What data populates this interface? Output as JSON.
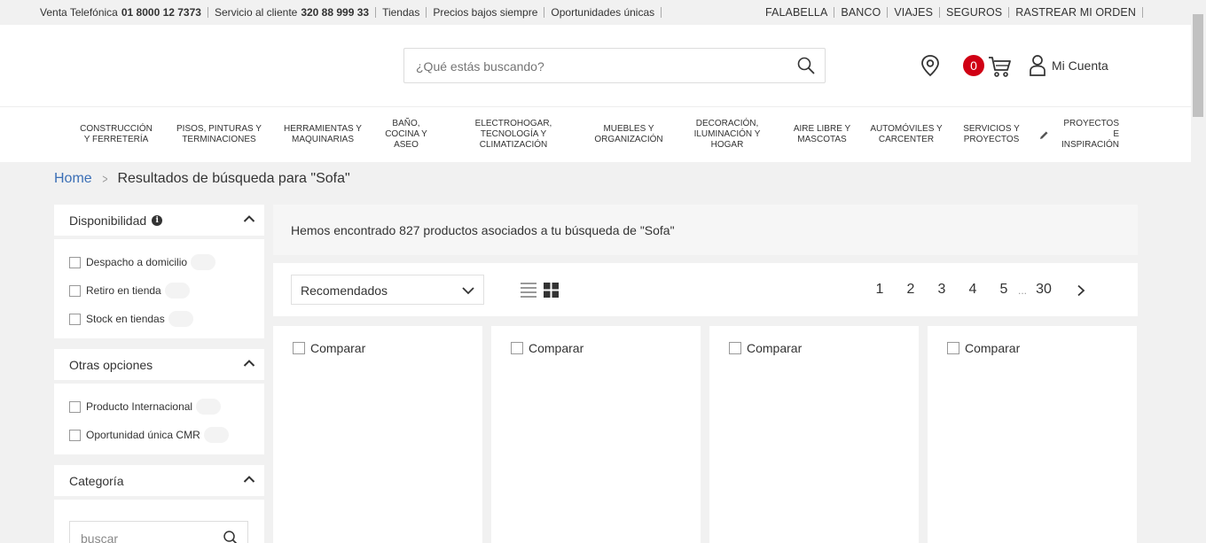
{
  "topbar": {
    "left": [
      {
        "label": "Venta Telefónica",
        "value": "01 8000 12 7373"
      },
      {
        "label": "Servicio al cliente",
        "value": "320 88 999 33"
      },
      {
        "label": "Tiendas"
      },
      {
        "label": "Precios bajos siempre"
      },
      {
        "label": "Oportunidades únicas"
      }
    ],
    "right": [
      "FALABELLA",
      "BANCO",
      "VIAJES",
      "SEGUROS",
      "RASTREAR MI ORDEN"
    ]
  },
  "header": {
    "search_placeholder": "¿Qué estás buscando?",
    "cart_count": "0",
    "account_label": "Mi Cuenta",
    "brand_color": "#d00014"
  },
  "nav": {
    "items": [
      "CONSTRUCCIÓN\nY FERRETERÍA",
      "PISOS, PINTURAS Y\nTERMINACIONES",
      "HERRAMIENTAS Y\nMAQUINARIAS",
      "BAÑO,\nCOCINA Y\nASEO",
      "ELECTROHOGAR,\nTECNOLOGÍA Y\nCLIMATIZACIÓN",
      "MUEBLES Y\nORGANIZACIÓN",
      "DECORACIÓN,\nILUMINACIÓN Y\nHOGAR",
      "AIRE LIBRE Y\nMASCOTAS",
      "AUTOMÓVILES Y\nCARCENTER",
      "SERVICIOS Y\nPROYECTOS",
      "PROYECTOS\nE\nINSPIRACIÓN"
    ]
  },
  "breadcrumb": {
    "home": "Home",
    "current": "Resultados de búsqueda para \"Sofa\""
  },
  "sidebar": {
    "disponibilidad": {
      "title": "Disponibilidad",
      "options": [
        "Despacho a domicilio",
        "Retiro en tienda",
        "Stock en tiendas"
      ]
    },
    "otras": {
      "title": "Otras opciones",
      "options": [
        "Producto Internacional",
        "Oportunidad única CMR"
      ]
    },
    "categoria": {
      "title": "Categoría",
      "search_placeholder": "buscar"
    }
  },
  "results": {
    "summary": "Hemos encontrado 827 productos asociados a tu búsqueda de \"Sofa\"",
    "sort_label": "Recomendados",
    "pages": [
      "1",
      "2",
      "3",
      "4",
      "5",
      "30"
    ],
    "ellipsis": "...",
    "compare_label": "Comparar"
  }
}
